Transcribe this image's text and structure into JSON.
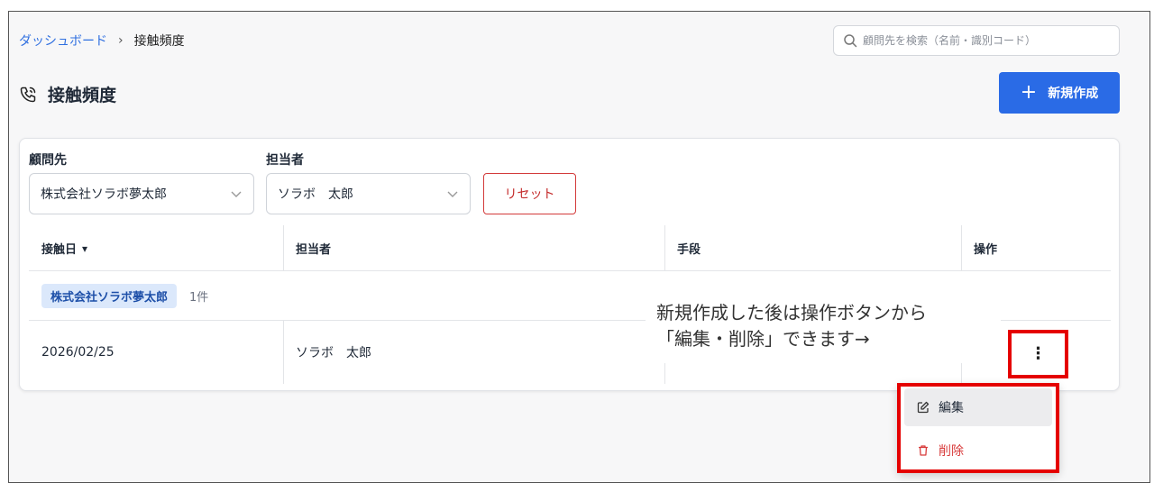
{
  "breadcrumb": {
    "home": "ダッシュボード",
    "separator": "›",
    "current": "接触頻度"
  },
  "search": {
    "placeholder": "顧問先を検索（名前・識別コード）"
  },
  "page": {
    "title": "接触頻度"
  },
  "toolbar": {
    "new_icon": "+",
    "new_label": "新規作成"
  },
  "filters": {
    "client_label": "顧問先",
    "client_value": "株式会社ソラボ夢太郎",
    "staff_label": "担当者",
    "staff_value": "ソラボ　太郎",
    "reset_label": "リセット"
  },
  "table": {
    "columns": [
      "接触日",
      "担当者",
      "手段",
      "操作"
    ],
    "sort_indicator": "▾",
    "group": {
      "name": "株式会社ソラボ夢太郎",
      "count": "1件"
    },
    "rows": [
      {
        "date": "2026/02/25",
        "staff": "ソラボ　太郎",
        "method": "",
        "action": "⋮"
      }
    ]
  },
  "annotation": {
    "line1": "新規作成した後は操作ボタンから",
    "line2": "「編集・削除」できます→"
  },
  "menu": {
    "edit_label": "編集",
    "delete_label": "削除"
  },
  "colors": {
    "accent": "#2a6be6",
    "danger": "#d83b3b",
    "highlight": "#e50000",
    "chip_bg": "#dbe8fb"
  },
  "icons": [
    "search-icon",
    "phone-icon",
    "plus-icon",
    "chevron-down-icon",
    "sort-caret-icon",
    "kebab-icon",
    "edit-icon",
    "trash-icon"
  ]
}
